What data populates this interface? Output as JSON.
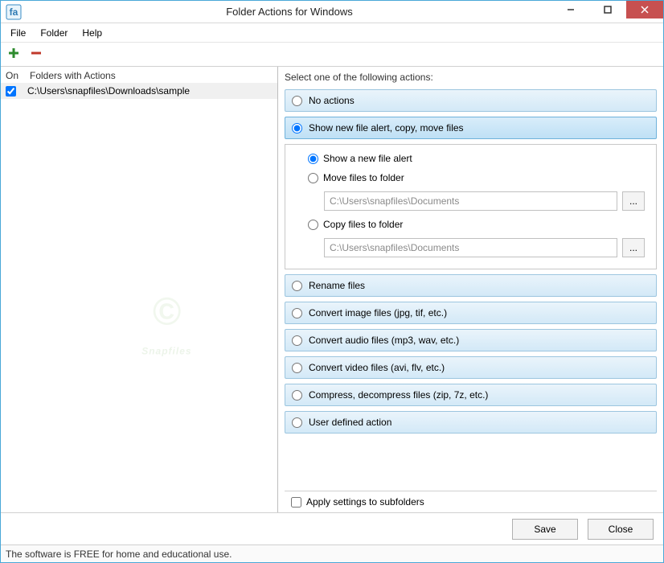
{
  "window": {
    "title": "Folder Actions for Windows"
  },
  "menu": {
    "file": "File",
    "folder": "Folder",
    "help": "Help"
  },
  "left": {
    "col_on": "On",
    "col_folders": "Folders with Actions",
    "rows": [
      {
        "checked": true,
        "path": "C:\\Users\\snapfiles\\Downloads\\sample"
      }
    ]
  },
  "right": {
    "prompt": "Select one of the following actions:",
    "options": {
      "none": "No actions",
      "alert": "Show new file alert, copy, move files",
      "rename": "Rename files",
      "image": "Convert image files (jpg, tif, etc.)",
      "audio": "Convert audio files (mp3, wav, etc.)",
      "video": "Convert video files (avi, flv, etc.)",
      "compress": "Compress, decompress files (zip, 7z, etc.)",
      "user": "User defined action"
    },
    "sub": {
      "show_alert": "Show a new file alert",
      "move": "Move files to folder",
      "move_path": "C:\\Users\\snapfiles\\Documents",
      "copy": "Copy files to folder",
      "copy_path": "C:\\Users\\snapfiles\\Documents",
      "browse": "..."
    },
    "subfolders": "Apply settings to subfolders"
  },
  "buttons": {
    "save": "Save",
    "close": "Close"
  },
  "status": "The software is FREE for home and educational use.",
  "watermark": "Snapfiles"
}
